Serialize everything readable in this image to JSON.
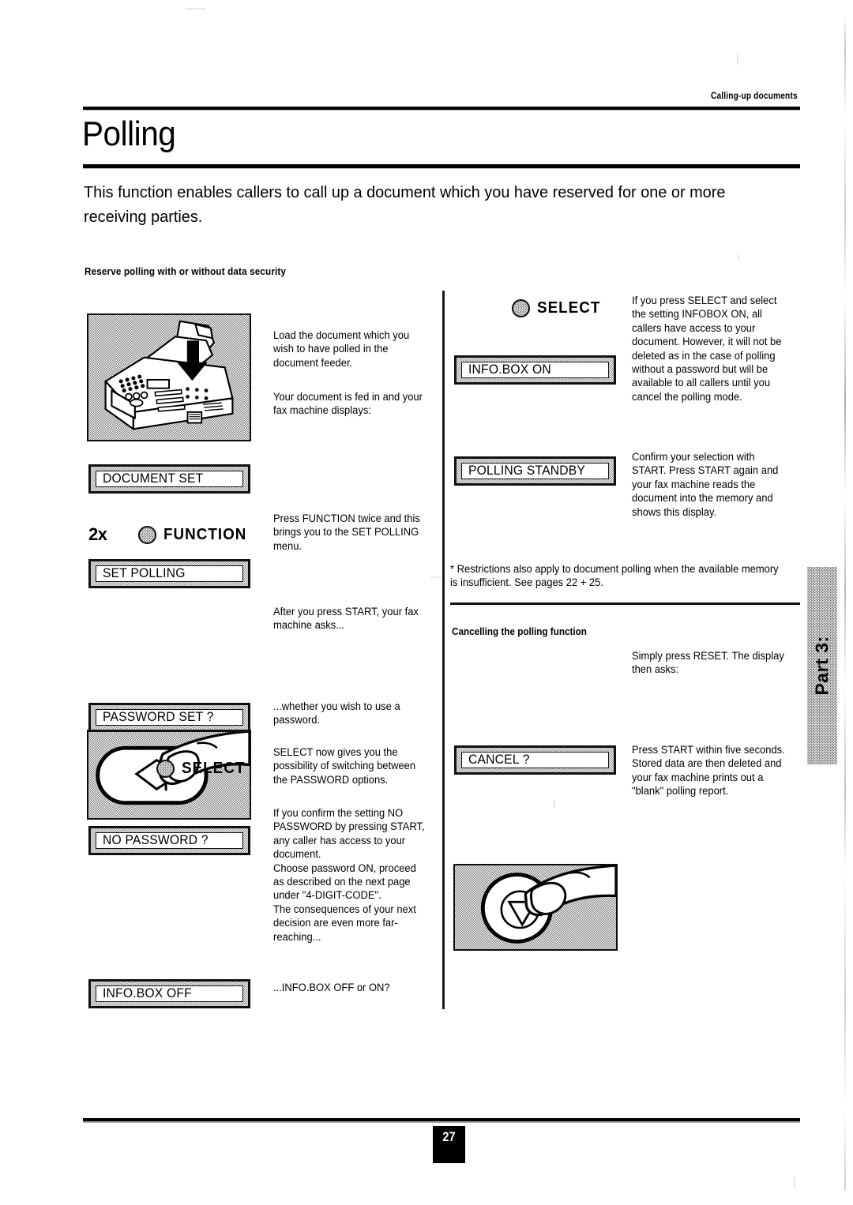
{
  "header": {
    "running_head": "Calling-up documents"
  },
  "title": "Polling",
  "intro": "This function enables callers to call up a document which you have reserved for one or more receiving parties.",
  "left_column": {
    "section_heading": "Reserve polling with or without data security",
    "fax_illustration_name": "fax-machine-document-feeder-illustration",
    "step1_text": "Load the document which you wish to have polled in the document feeder.",
    "step2_text": "Your document is fed in and your fax machine displays:",
    "display_1": "DOCUMENT SET",
    "key_function": {
      "count": "2x",
      "icon": "function-key-icon",
      "label": "FUNCTION"
    },
    "step3_text": "Press FUNCTION twice and this brings you to the SET POLLING menu.",
    "display_2": "SET POLLING",
    "start_illustration_name": "hand-pressing-start-key-illustration",
    "step4_text": "After you press START, your fax machine asks...",
    "display_3": "PASSWORD SET ?",
    "step5_text": "...whether you wish to use a password.",
    "key_select": {
      "icon": "select-key-icon",
      "label": "SELECT"
    },
    "step6_text": "SELECT now gives you the possibility of switching between the PASSWORD options.",
    "display_4": "NO PASSWORD ?",
    "step7_text": "If you confirm the setting NO PASSWORD by pressing START, any caller has access to your document.\nChoose password ON, proceed as described on the next page under \"4-DIGIT-CODE\".\nThe consequences of your next decision are even more far-reaching...",
    "display_5": "INFO.BOX OFF",
    "step8_text": "...INFO.BOX OFF or ON?"
  },
  "right_column": {
    "key_select": {
      "icon": "select-key-icon",
      "label": "SELECT"
    },
    "step1_text": "If you press SELECT and select the setting INFOBOX ON,  all callers have access to your document.  However, it will not be deleted as in the case of polling without a password but will be available to all callers until you cancel the polling mode.",
    "display_1": "INFO.BOX ON",
    "display_2": "POLLING STANDBY",
    "step2_text": "Confirm your selection with START.  Press START again and your fax machine reads the document into the memory and shows this display.",
    "footnote": "* Restrictions also apply to document polling when the available memory is insufficient.  See pages 22 + 25.",
    "section_heading": "Cancelling the polling function",
    "reset_illustration_name": "hand-pressing-reset-key-illustration",
    "step3_text": "Simply press RESET. The display then asks:",
    "display_3": "CANCEL ?",
    "step4_text": "Press START within five seconds. Stored data are then deleted and your fax machine prints out a \"blank\" polling report."
  },
  "side_tab": {
    "label": "Part 3:"
  },
  "footer": {
    "page_number": "27"
  },
  "colors": {
    "ink": "#000000",
    "paper": "#ffffff",
    "halftone": "#7e7e7e"
  }
}
